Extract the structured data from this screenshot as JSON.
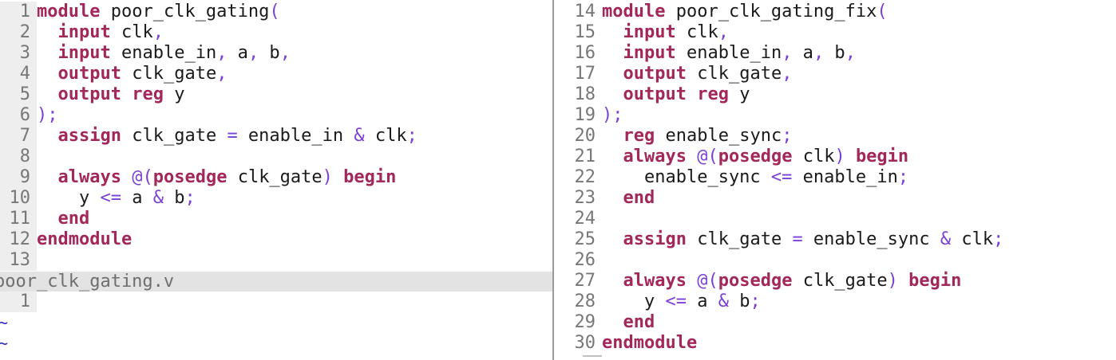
{
  "colors": {
    "keyword": "#a2275a",
    "operator": "#7a3fd6",
    "identifier": "#1a1a1a",
    "line_number": "#777777",
    "gutter_bg": "#eeeeee",
    "statusbar_bg": "#e3e3e3",
    "tilde": "#2e2ebf"
  },
  "left": {
    "lines": [
      {
        "n": "1",
        "t": [
          [
            "kw",
            "module"
          ],
          [
            "id",
            " poor_clk_gating"
          ],
          [
            "op",
            "("
          ]
        ]
      },
      {
        "n": "2",
        "t": [
          [
            "id",
            "  "
          ],
          [
            "kw",
            "input"
          ],
          [
            "id",
            " clk"
          ],
          [
            "op",
            ","
          ]
        ]
      },
      {
        "n": "3",
        "t": [
          [
            "id",
            "  "
          ],
          [
            "kw",
            "input"
          ],
          [
            "id",
            " enable_in"
          ],
          [
            "op",
            ","
          ],
          [
            "id",
            " a"
          ],
          [
            "op",
            ","
          ],
          [
            "id",
            " b"
          ],
          [
            "op",
            ","
          ]
        ]
      },
      {
        "n": "4",
        "t": [
          [
            "id",
            "  "
          ],
          [
            "kw",
            "output"
          ],
          [
            "id",
            " clk_gate"
          ],
          [
            "op",
            ","
          ]
        ]
      },
      {
        "n": "5",
        "t": [
          [
            "id",
            "  "
          ],
          [
            "kw",
            "output"
          ],
          [
            "id",
            " "
          ],
          [
            "kw",
            "reg"
          ],
          [
            "id",
            " y"
          ]
        ]
      },
      {
        "n": "6",
        "t": [
          [
            "op",
            ");"
          ]
        ]
      },
      {
        "n": "7",
        "t": [
          [
            "id",
            "  "
          ],
          [
            "kw",
            "assign"
          ],
          [
            "id",
            " clk_gate "
          ],
          [
            "op",
            "="
          ],
          [
            "id",
            " enable_in "
          ],
          [
            "op",
            "&"
          ],
          [
            "id",
            " clk"
          ],
          [
            "op",
            ";"
          ]
        ]
      },
      {
        "n": "8",
        "t": []
      },
      {
        "n": "9",
        "t": [
          [
            "id",
            "  "
          ],
          [
            "kw",
            "always"
          ],
          [
            "id",
            " "
          ],
          [
            "op",
            "@("
          ],
          [
            "kw",
            "posedge"
          ],
          [
            "id",
            " clk_gate"
          ],
          [
            "op",
            ")"
          ],
          [
            "id",
            " "
          ],
          [
            "kw",
            "begin"
          ]
        ]
      },
      {
        "n": "10",
        "t": [
          [
            "id",
            "    y "
          ],
          [
            "op",
            "<="
          ],
          [
            "id",
            " a "
          ],
          [
            "op",
            "&"
          ],
          [
            "id",
            " b"
          ],
          [
            "op",
            ";"
          ]
        ]
      },
      {
        "n": "11",
        "t": [
          [
            "id",
            "  "
          ],
          [
            "kw",
            "end"
          ]
        ]
      },
      {
        "n": "12",
        "t": [
          [
            "kw",
            "endmodule"
          ]
        ]
      },
      {
        "n": "13",
        "t": []
      }
    ],
    "filename": "poor_clk_gating.v",
    "cmd_line_number": "1",
    "tilde": "~"
  },
  "right": {
    "lines": [
      {
        "n": "14",
        "t": [
          [
            "kw",
            "module"
          ],
          [
            "id",
            " poor_clk_gating_fix"
          ],
          [
            "op",
            "("
          ]
        ]
      },
      {
        "n": "15",
        "t": [
          [
            "id",
            "  "
          ],
          [
            "kw",
            "input"
          ],
          [
            "id",
            " clk"
          ],
          [
            "op",
            ","
          ]
        ]
      },
      {
        "n": "16",
        "t": [
          [
            "id",
            "  "
          ],
          [
            "kw",
            "input"
          ],
          [
            "id",
            " enable_in"
          ],
          [
            "op",
            ","
          ],
          [
            "id",
            " a"
          ],
          [
            "op",
            ","
          ],
          [
            "id",
            " b"
          ],
          [
            "op",
            ","
          ]
        ]
      },
      {
        "n": "17",
        "t": [
          [
            "id",
            "  "
          ],
          [
            "kw",
            "output"
          ],
          [
            "id",
            " clk_gate"
          ],
          [
            "op",
            ","
          ]
        ]
      },
      {
        "n": "18",
        "t": [
          [
            "id",
            "  "
          ],
          [
            "kw",
            "output"
          ],
          [
            "id",
            " "
          ],
          [
            "kw",
            "reg"
          ],
          [
            "id",
            " y"
          ]
        ]
      },
      {
        "n": "19",
        "t": [
          [
            "op",
            ");"
          ]
        ]
      },
      {
        "n": "20",
        "t": [
          [
            "id",
            "  "
          ],
          [
            "kw",
            "reg"
          ],
          [
            "id",
            " enable_sync"
          ],
          [
            "op",
            ";"
          ]
        ]
      },
      {
        "n": "21",
        "t": [
          [
            "id",
            "  "
          ],
          [
            "kw",
            "always"
          ],
          [
            "id",
            " "
          ],
          [
            "op",
            "@("
          ],
          [
            "kw",
            "posedge"
          ],
          [
            "id",
            " clk"
          ],
          [
            "op",
            ")"
          ],
          [
            "id",
            " "
          ],
          [
            "kw",
            "begin"
          ]
        ]
      },
      {
        "n": "22",
        "t": [
          [
            "id",
            "    enable_sync "
          ],
          [
            "op",
            "<="
          ],
          [
            "id",
            " enable_in"
          ],
          [
            "op",
            ";"
          ]
        ]
      },
      {
        "n": "23",
        "t": [
          [
            "id",
            "  "
          ],
          [
            "kw",
            "end"
          ]
        ]
      },
      {
        "n": "24",
        "t": []
      },
      {
        "n": "25",
        "t": [
          [
            "id",
            "  "
          ],
          [
            "kw",
            "assign"
          ],
          [
            "id",
            " clk_gate "
          ],
          [
            "op",
            "="
          ],
          [
            "id",
            " enable_sync "
          ],
          [
            "op",
            "&"
          ],
          [
            "id",
            " clk"
          ],
          [
            "op",
            ";"
          ]
        ]
      },
      {
        "n": "26",
        "t": []
      },
      {
        "n": "27",
        "t": [
          [
            "id",
            "  "
          ],
          [
            "kw",
            "always"
          ],
          [
            "id",
            " "
          ],
          [
            "op",
            "@("
          ],
          [
            "kw",
            "posedge"
          ],
          [
            "id",
            " clk_gate"
          ],
          [
            "op",
            ")"
          ],
          [
            "id",
            " "
          ],
          [
            "kw",
            "begin"
          ]
        ]
      },
      {
        "n": "28",
        "t": [
          [
            "id",
            "    y "
          ],
          [
            "op",
            "<="
          ],
          [
            "id",
            " a "
          ],
          [
            "op",
            "&"
          ],
          [
            "id",
            " b"
          ],
          [
            "op",
            ";"
          ]
        ]
      },
      {
        "n": "29",
        "t": [
          [
            "id",
            "  "
          ],
          [
            "kw",
            "end"
          ]
        ]
      },
      {
        "n": "30",
        "t": [
          [
            "kw",
            "endmodule"
          ]
        ]
      }
    ]
  }
}
